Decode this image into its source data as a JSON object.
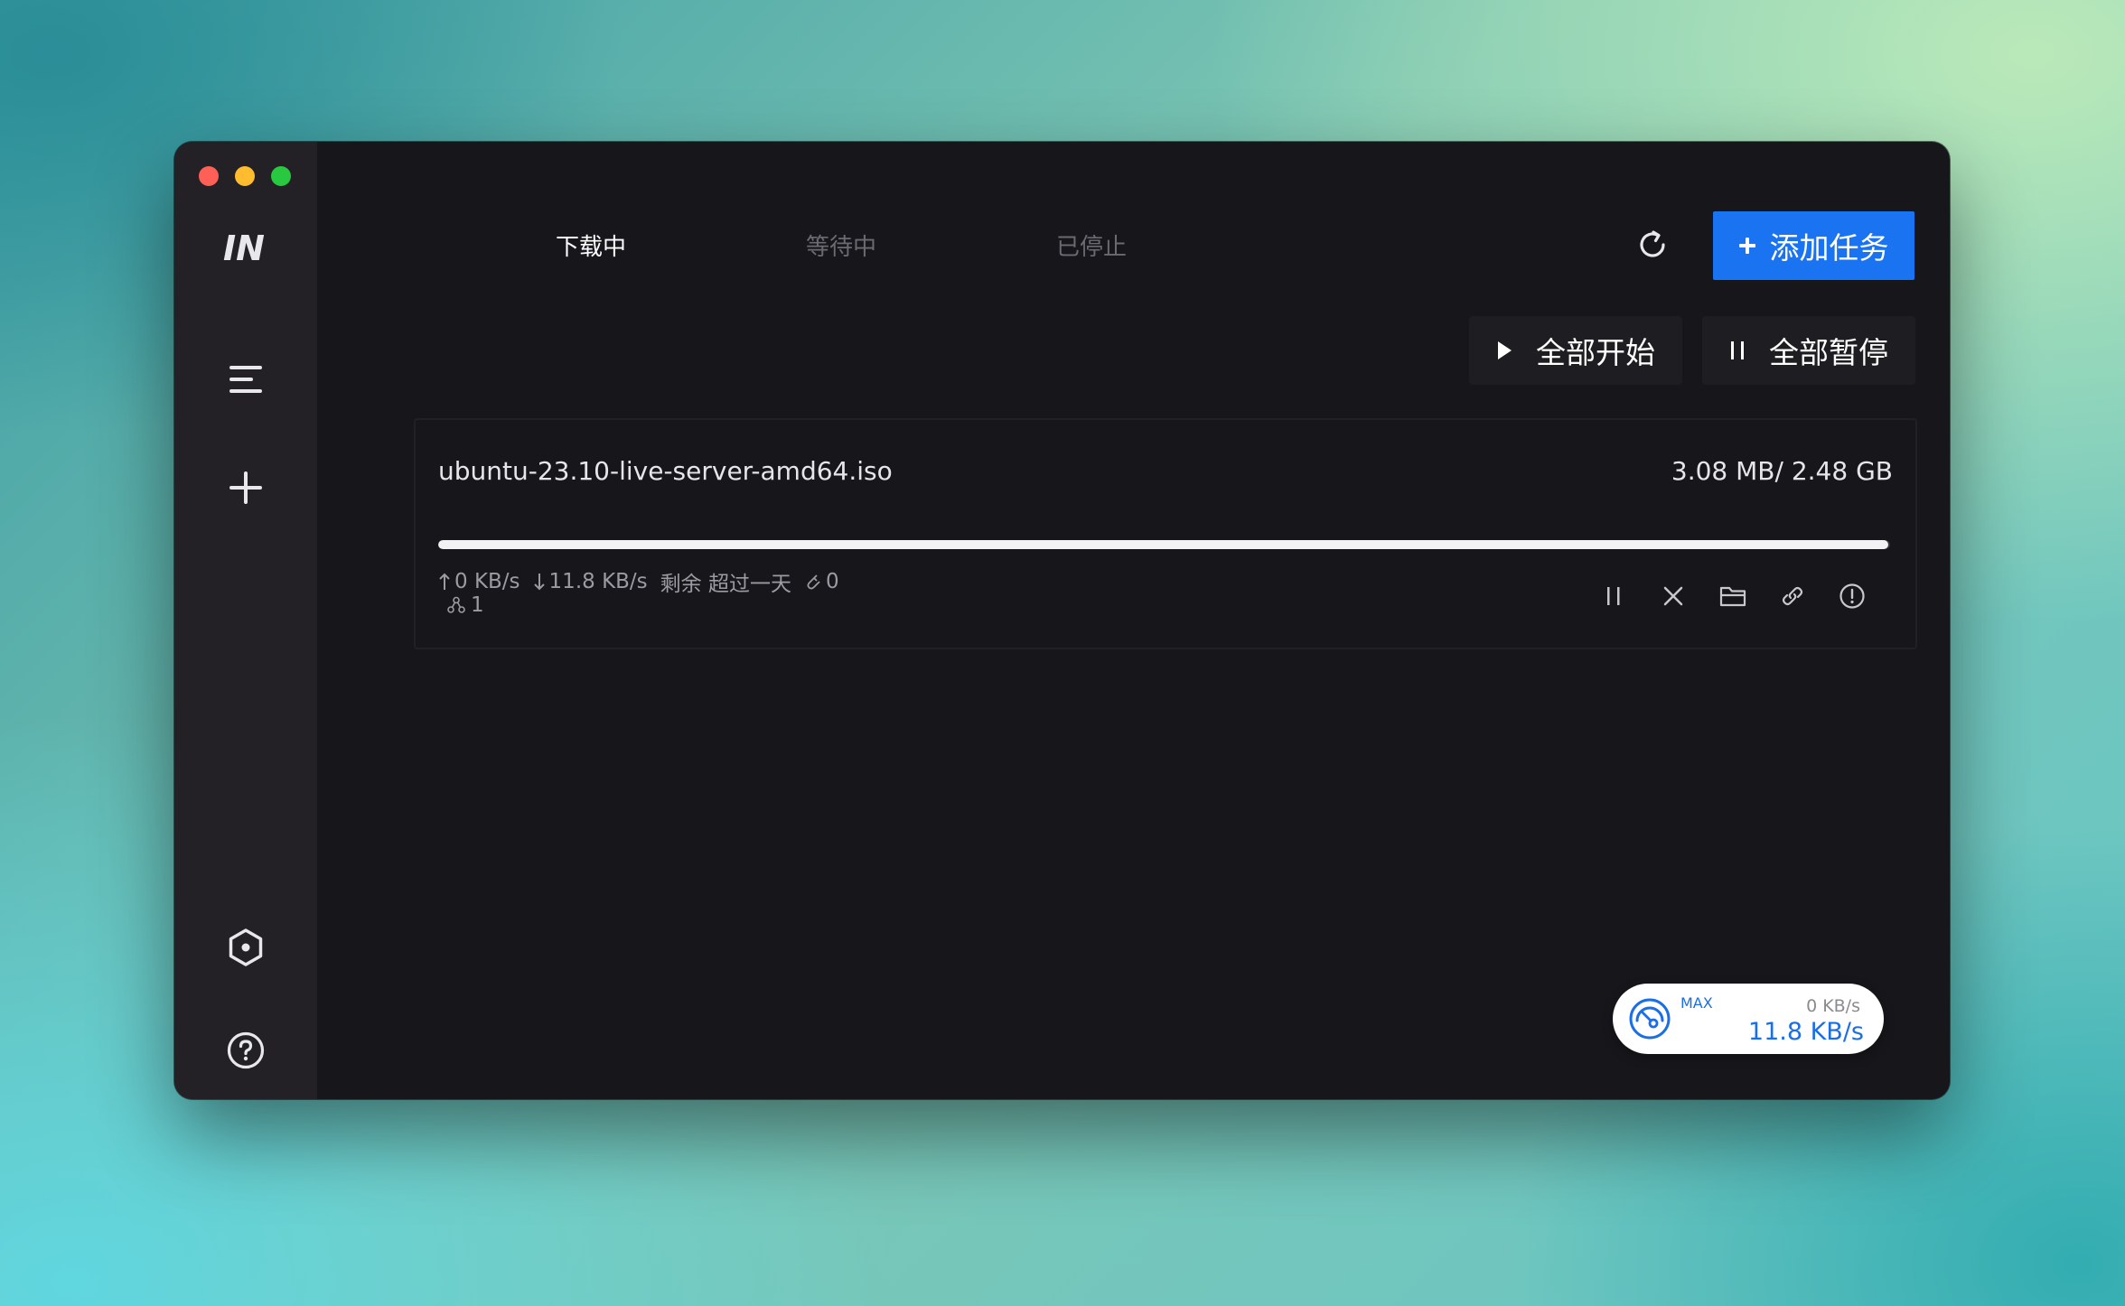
{
  "sidebar": {
    "logo_text": "IN",
    "items": [
      {
        "name": "task-list",
        "icon": "menu-icon"
      },
      {
        "name": "new-task",
        "icon": "plus-icon"
      },
      {
        "name": "settings",
        "icon": "settings-hexagon-icon"
      },
      {
        "name": "help",
        "icon": "help-icon"
      }
    ]
  },
  "tabs": [
    {
      "label": "下载中",
      "active": true
    },
    {
      "label": "等待中",
      "active": false
    },
    {
      "label": "已停止",
      "active": false
    }
  ],
  "toolbar": {
    "add_task_label": "添加任务",
    "start_all_label": "全部开始",
    "pause_all_label": "全部暂停"
  },
  "task": {
    "file_name": "ubuntu-23.10-live-server-amd64.iso",
    "size": "3.08 MB/ 2.48 GB",
    "progress_fraction": 0.999,
    "upload_speed": "0 KB/s",
    "download_speed": "11.8 KB/s",
    "remaining": "剩余 超过一天",
    "connections": "0",
    "peers": "1"
  },
  "speed": {
    "limit_label": "MAX",
    "upload": "0 KB/s",
    "download": "11.8 KB/s"
  },
  "colors": {
    "accent": "#1a73f0",
    "window_bg": "#17161b",
    "sidebar_bg": "#232126"
  }
}
